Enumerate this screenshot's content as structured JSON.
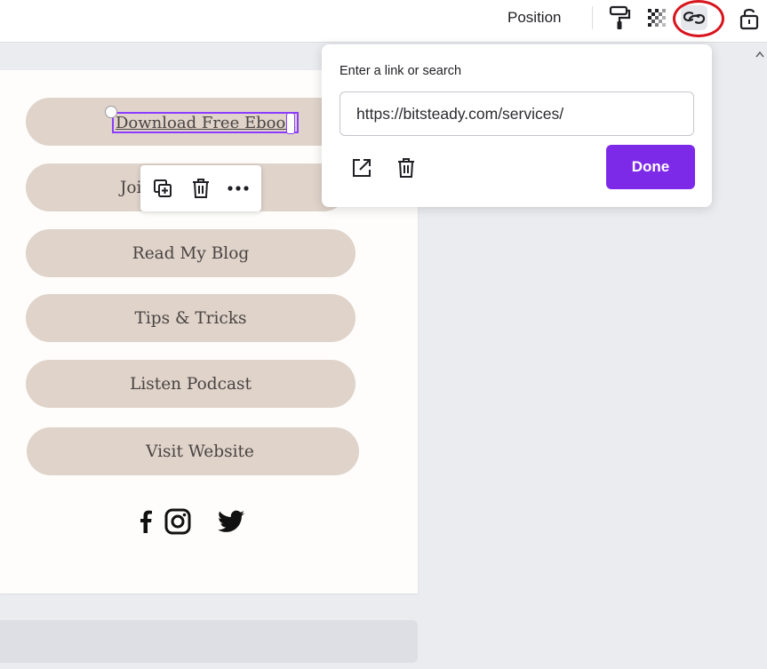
{
  "topbar": {
    "position_label": "Position",
    "icons": [
      "paint-roller-icon",
      "transparency-icon",
      "link-icon",
      "lock-icon"
    ]
  },
  "canvas": {
    "buttons": [
      {
        "label": "Download Free Ebook",
        "selected": true
      },
      {
        "label": "Joi"
      },
      {
        "label": "Read My Blog"
      },
      {
        "label": "Tips & Tricks"
      },
      {
        "label": "Listen Podcast"
      },
      {
        "label": "Visit Website"
      }
    ],
    "social_icons": [
      "facebook-icon",
      "instagram-icon",
      "twitter-icon"
    ],
    "mini_toolbar": [
      "duplicate-icon",
      "trash-icon",
      "more-icon"
    ]
  },
  "link_popover": {
    "label": "Enter a link or search",
    "url": "https://bitsteady.com/services/",
    "done_label": "Done",
    "icons": [
      "open-external-icon",
      "trash-icon"
    ]
  },
  "colors": {
    "accent": "#7d2ae8",
    "selection": "#8b3dff",
    "pill": "#dfd3ca",
    "annotation": "#d8141d"
  }
}
